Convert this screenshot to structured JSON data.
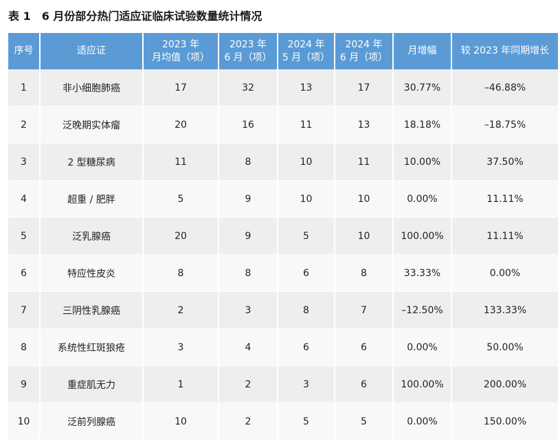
{
  "caption": {
    "number": "表 1",
    "title": "6 月份部分热门适应证临床试验数量统计情况"
  },
  "table": {
    "headers": [
      [
        "序号"
      ],
      [
        "适应证"
      ],
      [
        "2023 年",
        "月均值（项）"
      ],
      [
        "2023 年",
        "6 月（项）"
      ],
      [
        "2024 年",
        "5 月（项）"
      ],
      [
        "2024 年",
        "6 月（项）"
      ],
      [
        "月增幅"
      ],
      [
        "较 2023 年同期增长"
      ]
    ],
    "rows": [
      [
        "1",
        "非小细胞肺癌",
        "17",
        "32",
        "13",
        "17",
        "30.77%",
        "–46.88%"
      ],
      [
        "2",
        "泛晚期实体瘤",
        "20",
        "16",
        "11",
        "13",
        "18.18%",
        "–18.75%"
      ],
      [
        "3",
        "2 型糖尿病",
        "11",
        "8",
        "10",
        "11",
        "10.00%",
        "37.50%"
      ],
      [
        "4",
        "超重 / 肥胖",
        "5",
        "9",
        "10",
        "10",
        "0.00%",
        "11.11%"
      ],
      [
        "5",
        "泛乳腺癌",
        "20",
        "9",
        "5",
        "10",
        "100.00%",
        "11.11%"
      ],
      [
        "6",
        "特应性皮炎",
        "8",
        "8",
        "6",
        "8",
        "33.33%",
        "0.00%"
      ],
      [
        "7",
        "三阴性乳腺癌",
        "2",
        "3",
        "8",
        "7",
        "–12.50%",
        "133.33%"
      ],
      [
        "8",
        "系统性红斑狼疮",
        "3",
        "4",
        "6",
        "6",
        "0.00%",
        "50.00%"
      ],
      [
        "9",
        "重症肌无力",
        "1",
        "2",
        "3",
        "6",
        "100.00%",
        "200.00%"
      ],
      [
        "10",
        "泛前列腺癌",
        "10",
        "2",
        "5",
        "5",
        "0.00%",
        "150.00%"
      ]
    ]
  }
}
